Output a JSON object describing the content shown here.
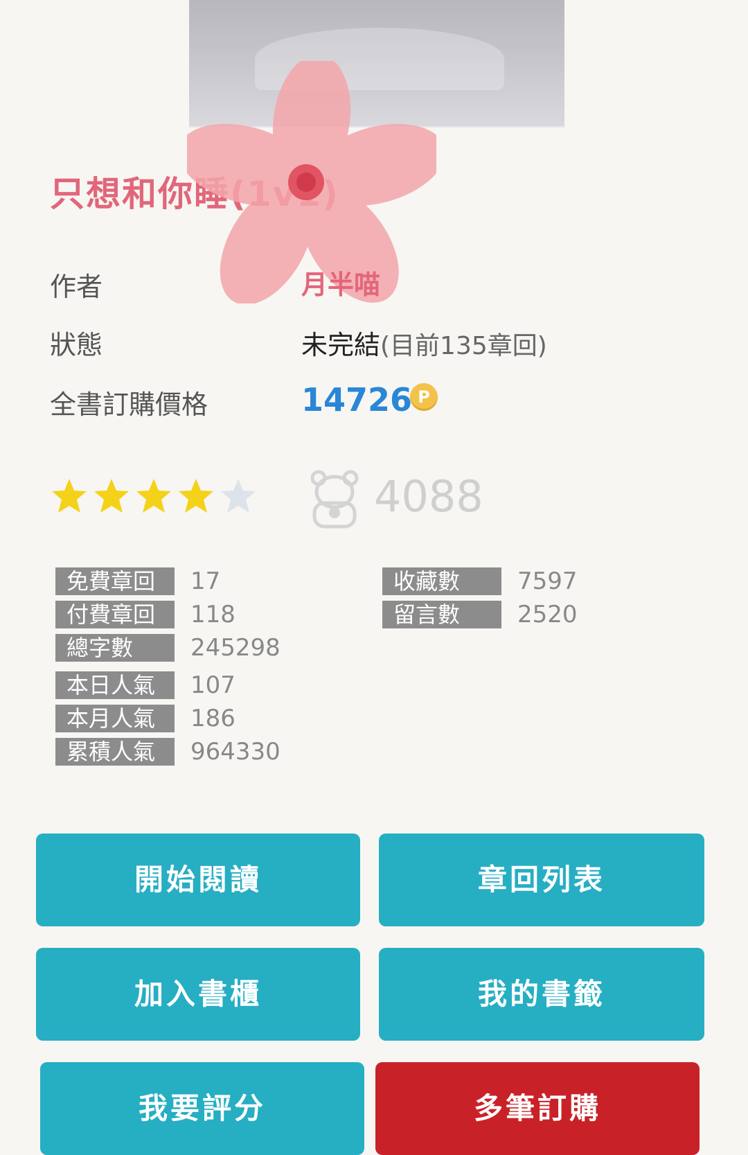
{
  "book": {
    "title": "只想和你睡(1v1)",
    "cover_alt": "book-cover"
  },
  "info": {
    "author_label": "作者",
    "author_value": "月半喵",
    "status_label": "狀態",
    "status_main": "未完結",
    "status_sub": "(目前135章回)",
    "price_label": "全書訂購價格",
    "price_value": "14726",
    "coin_symbol": "P"
  },
  "rating": {
    "stars_filled": 4,
    "stars_total": 5,
    "votes": "4088",
    "colors": {
      "filled": "#f5d21a",
      "empty": "#dde3ea"
    }
  },
  "stats": {
    "left": [
      {
        "label": "免費章回",
        "value": "17"
      },
      {
        "label": "付費章回",
        "value": "118"
      },
      {
        "label": "總字數",
        "value": "245298"
      },
      {
        "label": "本日人氣",
        "value": "107"
      },
      {
        "label": "本月人氣",
        "value": "186"
      },
      {
        "label": "累積人氣",
        "value": "964330"
      }
    ],
    "right": [
      {
        "label": "收藏數",
        "value": "7597"
      },
      {
        "label": "留言數",
        "value": "2520"
      }
    ]
  },
  "buttons": {
    "start_reading": "開始閱讀",
    "chapter_list": "章回列表",
    "add_bookshelf": "加入書櫃",
    "my_bookmarks": "我的書籤",
    "rate": "我要評分",
    "bulk_purchase": "多筆訂購"
  },
  "colors": {
    "teal": "#26aec3",
    "red": "#c82228",
    "title_pink": "#e2667a",
    "price_blue": "#2a86d6"
  }
}
